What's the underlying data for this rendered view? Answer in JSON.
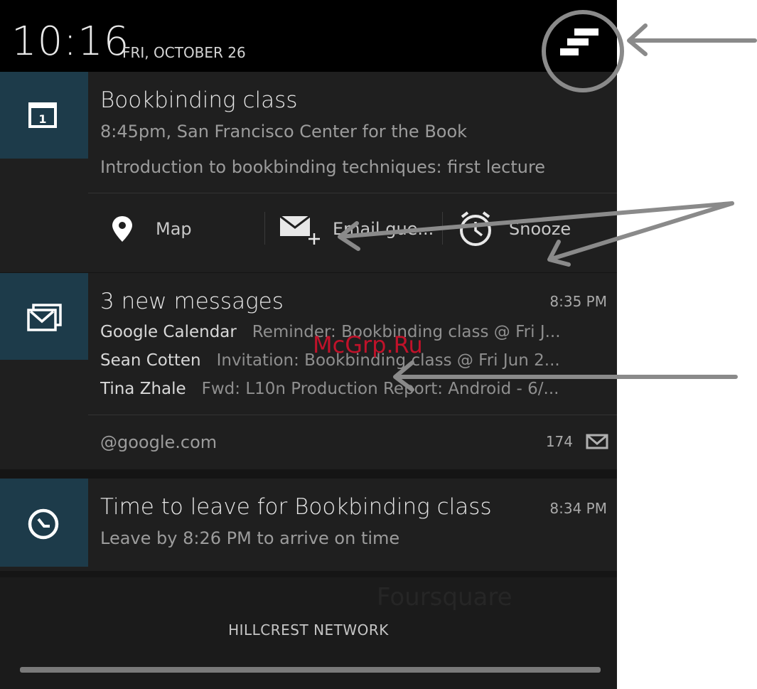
{
  "status_bar": {
    "time": "10:16",
    "date": "FRI, OCTOBER 26"
  },
  "calendar_notification": {
    "title": "Bookbinding class",
    "line1": "8:45pm, San Francisco Center for the Book",
    "line2": "Introduction to bookbinding techniques: first lecture",
    "tile_icon": "calendar-icon",
    "actions": [
      {
        "label": "Map",
        "icon": "map-pin-icon"
      },
      {
        "label": "Email gue...",
        "icon": "email-add-icon"
      },
      {
        "label": "Snooze",
        "icon": "clock-icon"
      }
    ]
  },
  "gmail_notification": {
    "title": "3 new messages",
    "time": "8:35 PM",
    "tile_icon": "gmail-icon",
    "messages": [
      {
        "from": "Google Calendar",
        "snippet": "Reminder: Bookbinding class @ Fri J..."
      },
      {
        "from": "Sean Cotten",
        "snippet": "Invitation: Bookbinding class @ Fri Jun 2..."
      },
      {
        "from": "Tina Zhale",
        "snippet": "Fwd: L10n Production Report: Android - 6/..."
      }
    ],
    "account": "@google.com",
    "count": "174"
  },
  "leave_notification": {
    "title": "Time to leave for Bookbinding class",
    "time": "8:34 PM",
    "subtitle": "Leave by 8:26 PM to arrive on time",
    "tile_icon": "clock-icon"
  },
  "background_text": "Foursquare",
  "network": "HILLCREST NETWORK",
  "watermark": "McGrp.Ru",
  "colors": {
    "tile": "#1d3b4a",
    "panel": "#1f1f1f",
    "annotation": "#8a8a8a",
    "watermark": "#c0122a"
  }
}
